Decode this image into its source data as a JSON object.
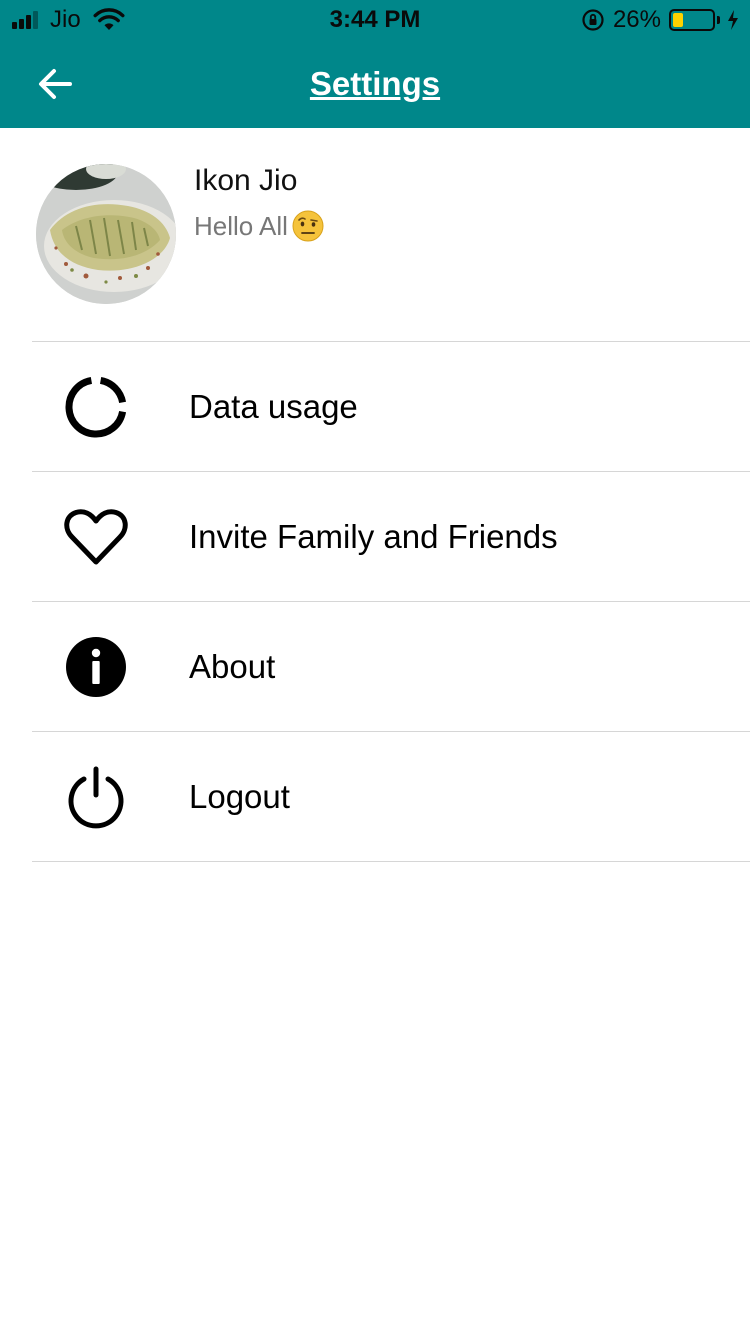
{
  "status_bar": {
    "carrier": "Jio",
    "time": "3:44 PM",
    "battery_percent": "26%",
    "battery_level": 0.26,
    "battery_color": "#ffd200"
  },
  "header": {
    "title": "Settings",
    "back_icon": "arrow-left-icon",
    "background_color": "#00878a"
  },
  "profile": {
    "name": "Ikon Jio",
    "status": "Hello All",
    "status_emoji": "face-with-raised-eyebrow-icon",
    "avatar": "food-photo-avatar"
  },
  "menu": {
    "items": [
      {
        "label": "Data usage",
        "icon": "data-usage-ring-icon"
      },
      {
        "label": "Invite Family and Friends",
        "icon": "heart-outline-icon"
      },
      {
        "label": "About",
        "icon": "info-circle-icon"
      },
      {
        "label": "Logout",
        "icon": "power-icon"
      }
    ]
  }
}
